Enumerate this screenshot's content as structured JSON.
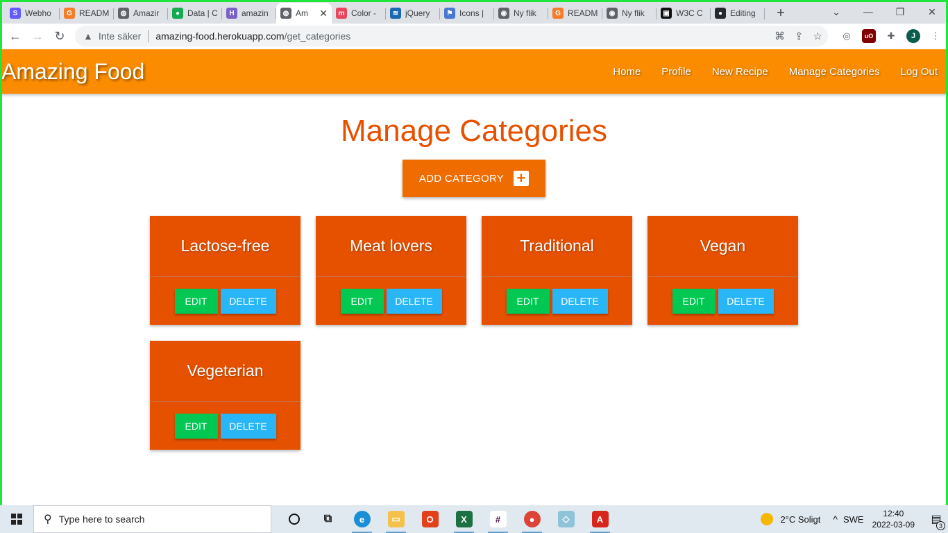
{
  "browser": {
    "tabs": [
      {
        "title": "Webho",
        "icon": "s-icon",
        "color": "#635bff",
        "glyph": "S"
      },
      {
        "title": "READM",
        "icon": "g-icon",
        "color": "#f57c28",
        "glyph": "G"
      },
      {
        "title": "Amazir",
        "icon": "globe-icon",
        "color": "#5f6368",
        "glyph": "◍"
      },
      {
        "title": "Data | C",
        "icon": "leaf-icon",
        "color": "#13aa52",
        "glyph": "●"
      },
      {
        "title": "amazin",
        "icon": "h-icon",
        "color": "#7b61c4",
        "glyph": "H"
      },
      {
        "title": "Am",
        "icon": "globe-icon",
        "color": "#5f6368",
        "glyph": "◍",
        "active": true
      },
      {
        "title": "Color -",
        "icon": "m-icon",
        "color": "#e8465d",
        "glyph": "m"
      },
      {
        "title": "jQuery",
        "icon": "jquery-icon",
        "color": "#1a68b2",
        "glyph": "≋"
      },
      {
        "title": "Icons |",
        "icon": "flag-icon",
        "color": "#4a78d0",
        "glyph": "⚑"
      },
      {
        "title": "Ny flik",
        "icon": "chrome-icon",
        "color": "#5f6368",
        "glyph": "◉"
      },
      {
        "title": "READM",
        "icon": "g-icon",
        "color": "#f57c28",
        "glyph": "G"
      },
      {
        "title": "Ny flik",
        "icon": "chrome-icon",
        "color": "#5f6368",
        "glyph": "◉"
      },
      {
        "title": "W3C C",
        "icon": "w3c-icon",
        "color": "#111111",
        "glyph": "▣"
      },
      {
        "title": "Editing",
        "icon": "github-icon",
        "color": "#24292e",
        "glyph": "●"
      }
    ],
    "insecure_label": "Inte säker",
    "url_host": "amazing-food.herokuapp.com",
    "url_path": "/get_categories",
    "profile_initial": "J"
  },
  "site": {
    "brand": "Amazing Food",
    "nav": [
      "Home",
      "Profile",
      "New Recipe",
      "Manage Categories",
      "Log Out"
    ]
  },
  "main": {
    "title": "Manage Categories",
    "add_button": "ADD CATEGORY",
    "categories": [
      {
        "name": "Lactose-free"
      },
      {
        "name": "Meat lovers"
      },
      {
        "name": "Traditional"
      },
      {
        "name": "Vegan"
      },
      {
        "name": "Vegeterian"
      }
    ],
    "edit_label": "EDIT",
    "delete_label": "DELETE"
  },
  "taskbar": {
    "search_placeholder": "Type here to search",
    "weather": "2°C  Soligt",
    "language": "SWE",
    "time": "12:40",
    "date": "2022-03-09",
    "notifications": "3"
  },
  "colors": {
    "header": "#fb8c00",
    "title": "#e65100",
    "card": "#e65100",
    "edit": "#00c853",
    "delete": "#29b6f6"
  }
}
